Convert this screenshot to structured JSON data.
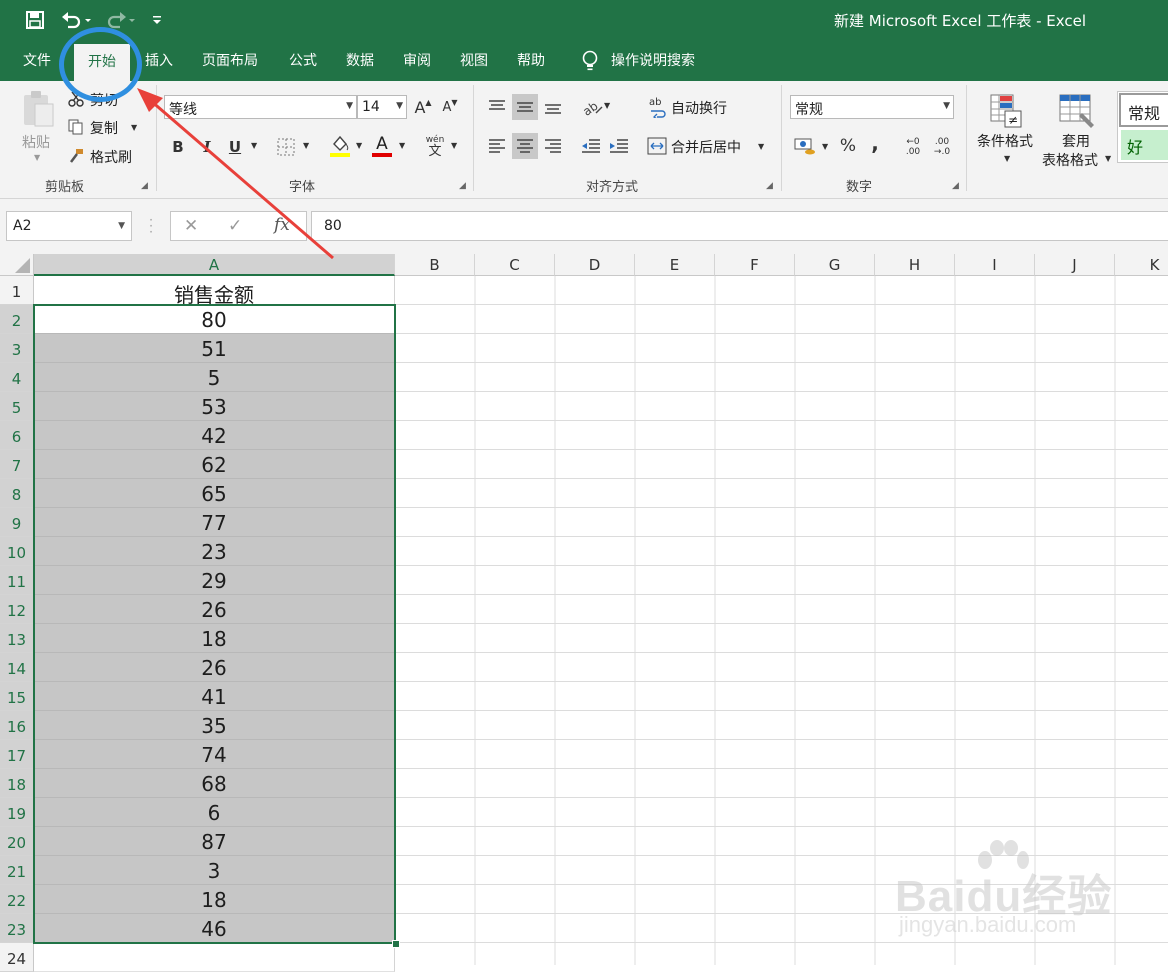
{
  "window": {
    "title": "新建 Microsoft Excel 工作表  -  Excel"
  },
  "qat": {
    "save_icon": "save-icon",
    "undo_icon": "undo-icon",
    "redo_icon": "redo-icon",
    "customize_icon": "customize-qat-icon"
  },
  "tabs": [
    {
      "label": "文件"
    },
    {
      "label": "开始"
    },
    {
      "label": "插入"
    },
    {
      "label": "页面布局"
    },
    {
      "label": "公式"
    },
    {
      "label": "数据"
    },
    {
      "label": "审阅"
    },
    {
      "label": "视图"
    },
    {
      "label": "帮助"
    },
    {
      "label": "操作说明搜索"
    }
  ],
  "active_tab": "开始",
  "ribbon": {
    "clipboard": {
      "paste": "粘贴",
      "cut": "剪切",
      "copy": "复制",
      "format_painter": "格式刷",
      "group_label": "剪贴板"
    },
    "font": {
      "name": "等线",
      "size": "14",
      "group_label": "字体",
      "bold": "B",
      "italic": "I",
      "underline": "U",
      "font_color_glyph": "A",
      "phonetic_top": "wén",
      "phonetic_bottom": "文"
    },
    "alignment": {
      "wrap_text": "自动换行",
      "merge_center": "合并后居中",
      "group_label": "对齐方式"
    },
    "number": {
      "format": "常规",
      "percent": "%",
      "comma": ",",
      "group_label": "数字",
      "inc_decimal_top": "←0",
      "inc_decimal_bottom": ".00",
      "dec_decimal_top": ".00",
      "dec_decimal_bottom": "→.0"
    },
    "styles": {
      "conditional_format": "条件格式",
      "table_format_1": "套用",
      "table_format_2": "表格格式",
      "style_normal": "常规",
      "style_good": "好"
    }
  },
  "formula_bar": {
    "name_box": "A2",
    "formula": "80",
    "fx": "fx",
    "cancel": "✕",
    "enter": "✓"
  },
  "columns": [
    "A",
    "B",
    "C",
    "D",
    "E",
    "F",
    "G",
    "H",
    "I",
    "J",
    "K"
  ],
  "rows": [
    "1",
    "2",
    "3",
    "4",
    "5",
    "6",
    "7",
    "8",
    "9",
    "10",
    "11",
    "12",
    "13",
    "14",
    "15",
    "16",
    "17",
    "18",
    "19",
    "20",
    "21",
    "22",
    "23",
    "24"
  ],
  "cells": {
    "A": [
      "销售金额",
      "80",
      "51",
      "5",
      "53",
      "42",
      "62",
      "65",
      "77",
      "23",
      "29",
      "26",
      "18",
      "26",
      "41",
      "35",
      "74",
      "68",
      "6",
      "87",
      "3",
      "18",
      "46",
      ""
    ]
  },
  "watermark": {
    "brand": "Baidu经验",
    "url": "jingyan.baidu.com"
  },
  "colors": {
    "excel_green": "#217346",
    "annotation_circle": "#2f8fe0",
    "annotation_arrow": "#e8403a",
    "selection_fill": "#c6c6c6"
  }
}
